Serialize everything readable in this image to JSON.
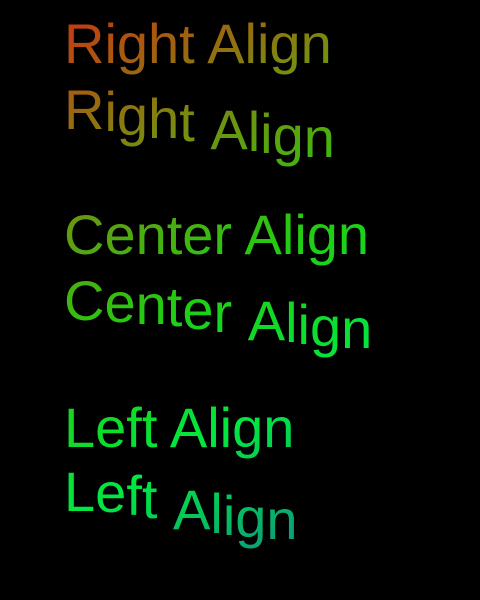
{
  "background": "#000000",
  "gradient": {
    "colors": [
      "#cc3311",
      "#7a8a10",
      "#22cc11",
      "#00e840",
      "#108090"
    ]
  },
  "rows": [
    {
      "id": "right-align-straight",
      "text": "Right Align",
      "style": "straight"
    },
    {
      "id": "right-align-wavy",
      "text": "Right Align",
      "style": "wavy"
    },
    {
      "id": "center-align-straight",
      "text": "Center Align",
      "style": "straight"
    },
    {
      "id": "center-align-wavy",
      "text": "Center Align",
      "style": "wavy"
    },
    {
      "id": "left-align-straight",
      "text": "Left Align",
      "style": "straight"
    },
    {
      "id": "left-align-wavy",
      "text": "Left Align",
      "style": "wavy"
    }
  ]
}
